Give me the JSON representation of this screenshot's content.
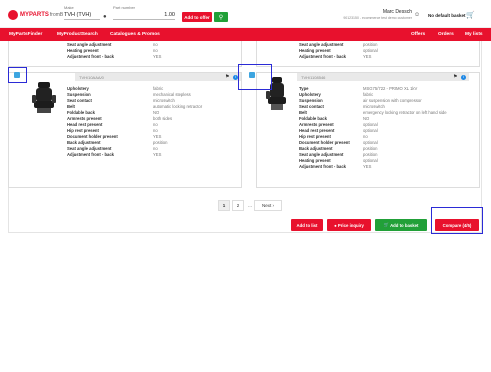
{
  "header": {
    "logo_text": "MYPARTS",
    "logo_sub": "fromB",
    "make_label": "Make",
    "make_value": "TVH (TVH)",
    "partnum_label": "Part number",
    "partnum_qty": "1.00",
    "add_offer_label": "Add to offer",
    "user_name": "Marc Dessch",
    "user_sub": "90123150 - ecommerce test demo customer",
    "basket_label": "No default basket"
  },
  "nav": {
    "items": [
      "MyPartsFinder",
      "MyProductSearch",
      "Catalogues & Promos"
    ],
    "right_items": [
      "Offers",
      "Orders",
      "My lists"
    ]
  },
  "cards": [
    {
      "top_specs": [
        {
          "k": "Seat angle adjustment",
          "v": "no"
        },
        {
          "k": "Heating present",
          "v": "no"
        },
        {
          "k": "Adjustment front - back",
          "v": "YES"
        }
      ],
      "title": "TVH/10AAA/0",
      "specs": [
        {
          "k": "Upholstery",
          "v": "fabric"
        },
        {
          "k": "Suspension",
          "v": "mechanical stepless"
        },
        {
          "k": "Seat contact",
          "v": "microswitch"
        },
        {
          "k": "Belt",
          "v": "automatic locking retractor"
        },
        {
          "k": "Foldable back",
          "v": "NO"
        },
        {
          "k": "Armrests present",
          "v": "both sides"
        },
        {
          "k": "Head rest present",
          "v": "no"
        },
        {
          "k": "Hip rest present",
          "v": "no"
        },
        {
          "k": "Document holder present",
          "v": "YES"
        },
        {
          "k": "Back adjustment",
          "v": "position"
        },
        {
          "k": "Seat angle adjustment",
          "v": "no"
        },
        {
          "k": "Adjustment front - back",
          "v": "YES"
        }
      ]
    },
    {
      "top_specs": [
        {
          "k": "Seat angle adjustment",
          "v": "position"
        },
        {
          "k": "Heating present",
          "v": "optional"
        },
        {
          "k": "Adjustment front - back",
          "v": "YES"
        }
      ],
      "title": "TVH/1108546",
      "specs": [
        {
          "k": "Type",
          "v": "MSG75/722 - PRIMO XL 1kV"
        },
        {
          "k": "Upholstery",
          "v": "fabric"
        },
        {
          "k": "Suspension",
          "v": "air suspension with compressor"
        },
        {
          "k": "Seat contact",
          "v": "microswitch"
        },
        {
          "k": "Belt",
          "v": "emergency locking retractor on left hand side"
        },
        {
          "k": "Foldable back",
          "v": "NO"
        },
        {
          "k": "Armrests present",
          "v": "optional"
        },
        {
          "k": "Head rest present",
          "v": "optional"
        },
        {
          "k": "Hip rest present",
          "v": "no"
        },
        {
          "k": "Document holder present",
          "v": "optional"
        },
        {
          "k": "Back adjustment",
          "v": "position"
        },
        {
          "k": "Seat angle adjustment",
          "v": "position"
        },
        {
          "k": "Heating present",
          "v": "optional"
        },
        {
          "k": "Adjustment front - back",
          "v": "YES"
        }
      ]
    }
  ],
  "pagination": {
    "pages": [
      "1",
      "2"
    ],
    "next_label": "Next"
  },
  "actions": {
    "add_to_list": "Add to list",
    "price_inquiry": "Price inquiry",
    "add_to_basket": "Add to basket",
    "compare": "Compare (4/5)"
  },
  "colors": {
    "brand_red": "#e8112d",
    "green": "#21a038",
    "highlight_blue": "#2b2bd6"
  }
}
